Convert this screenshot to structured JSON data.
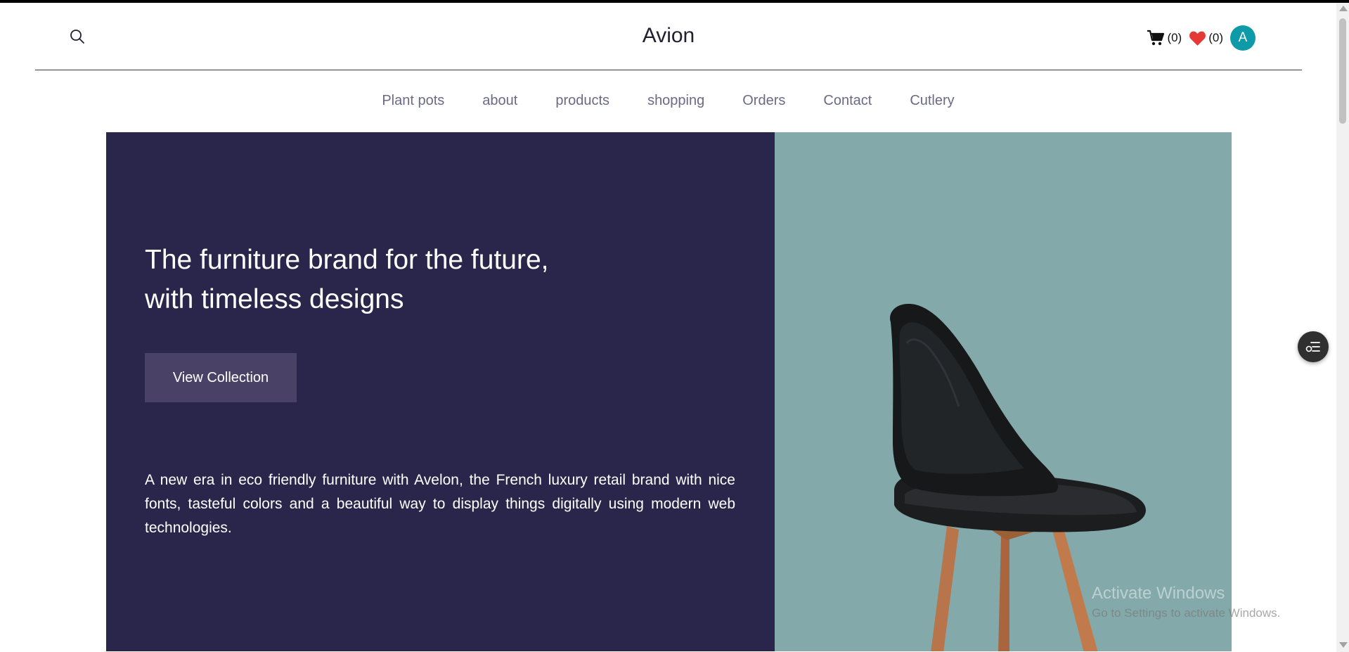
{
  "header": {
    "brand": "Avion",
    "cart_count": "(0)",
    "wishlist_count": "(0)",
    "avatar_initial": "A"
  },
  "nav": {
    "items": [
      "Plant pots",
      "about",
      "products",
      "shopping",
      "Orders",
      "Contact",
      "Cutlery"
    ]
  },
  "hero": {
    "title_line1": "The furniture brand for the future,",
    "title_line2": "with timeless designs",
    "button_label": "View Collection",
    "description": "A new era in eco friendly furniture with Avelon, the French luxury retail brand with nice fonts, tasteful colors and a beautiful way to display things digitally using modern web technologies."
  },
  "watermark": {
    "line1": "Activate Windows",
    "line2": "Go to Settings to activate Windows."
  },
  "colors": {
    "hero_dark": "#2a254b",
    "hero_teal": "#83a9ab",
    "button": "#4a4266",
    "avatar": "#0e9aa7",
    "heart": "#e53935",
    "nav_text": "#6b6a85"
  },
  "icons": {
    "search": "search-icon",
    "cart": "cart-icon",
    "heart": "heart-icon",
    "floating": "list-settings-icon"
  }
}
